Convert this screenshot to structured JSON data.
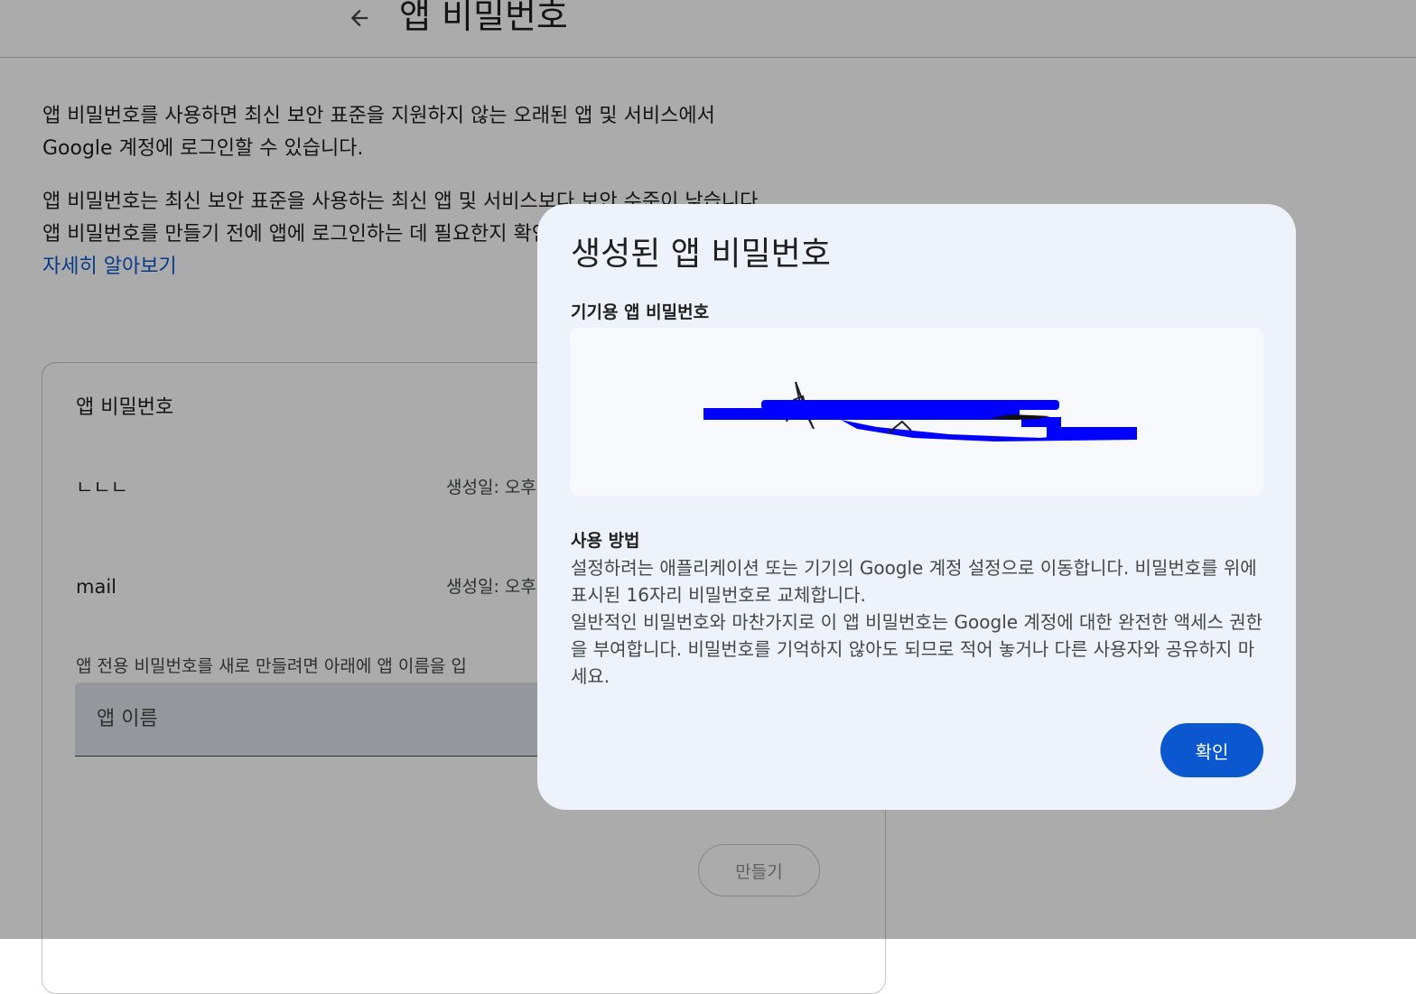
{
  "header": {
    "title": "앱 비밀번호"
  },
  "intro": {
    "paragraph1": "앱 비밀번호를 사용하면 최신 보안 표준을 지원하지 않는 오래된 앱 및 서비스에서 Google 계정에 로그인할 수 있습니다.",
    "paragraph2": "앱 비밀번호는 최신 보안 표준을 사용하는 최신 앱 및 서비스보다 보안 수준이 낮습니다. 앱 비밀번호를 만들기 전에 앱에 로그인하는 데 필요한지 확인해야 합니다.",
    "learn_more": "자세히 알아보기"
  },
  "card": {
    "title": "앱 비밀번호",
    "passwords": [
      {
        "name": "ㄴㄴㄴ",
        "created": "생성일: 오후"
      },
      {
        "name": "mail",
        "created": "생성일: 오후"
      }
    ],
    "new_hint": "앱 전용 비밀번호를 새로 만들려면 아래에 앱 이름을 입",
    "app_name_placeholder": "앱 이름",
    "create_label": "만들기"
  },
  "dialog": {
    "title": "생성된 앱 비밀번호",
    "device_label": "기기용 앱 비밀번호",
    "redaction_color": "#0000ff",
    "howto_label": "사용 방법",
    "howto_para1": "설정하려는 애플리케이션 또는 기기의 Google 계정 설정으로 이동합니다. 비밀번호를 위에 표시된 16자리 비밀번호로 교체합니다.",
    "howto_para2": "일반적인 비밀번호와 마찬가지로 이 앱 비밀번호는 Google 계정에 대한 완전한 액세스 권한을 부여합니다. 비밀번호를 기억하지 않아도 되므로 적어 놓거나 다른 사용자와 공유하지 마세요.",
    "confirm_label": "확인"
  },
  "colors": {
    "accent": "#0b57d0",
    "dialog_bg": "#eef2fa",
    "scrim": "rgba(0,0,0,0.33)"
  }
}
